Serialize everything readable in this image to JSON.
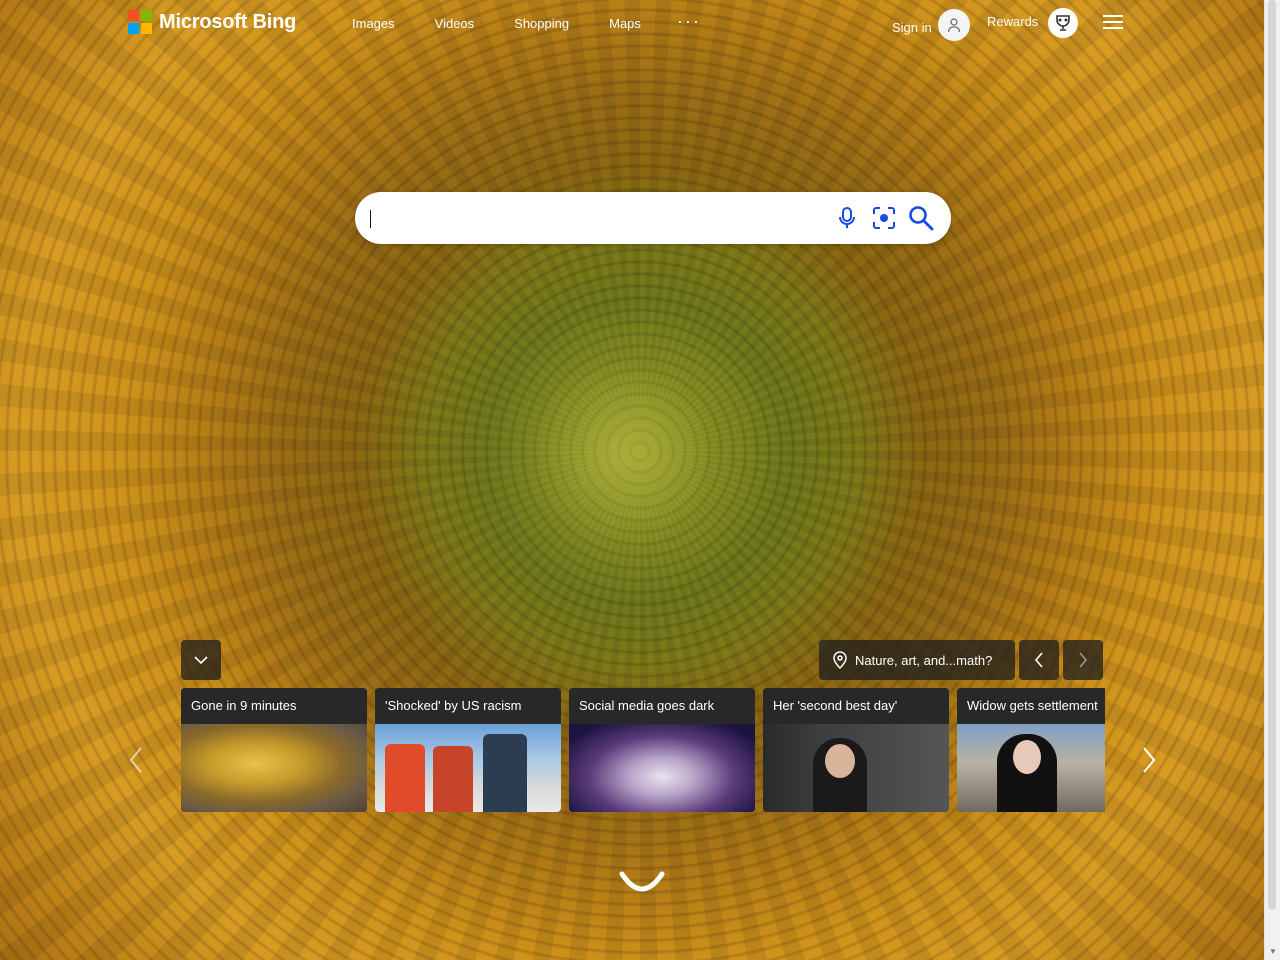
{
  "brand": {
    "name": "Microsoft Bing",
    "logo_colors": [
      "#f25022",
      "#7fba00",
      "#00a4ef",
      "#ffb900"
    ]
  },
  "nav": {
    "items": [
      "Images",
      "Videos",
      "Shopping",
      "Maps"
    ],
    "more": "···"
  },
  "account": {
    "signin_label": "Sign in",
    "rewards_label": "Rewards"
  },
  "search": {
    "value": "",
    "placeholder": ""
  },
  "hero": {
    "location_label": "Nature, art, and...math?"
  },
  "news": [
    {
      "title": "Gone in 9 minutes"
    },
    {
      "title": "'Shocked' by US racism"
    },
    {
      "title": "Social media goes dark"
    },
    {
      "title": "Her 'second best day'"
    },
    {
      "title": "Widow gets settlement"
    }
  ],
  "colors": {
    "accent": "#ffffff",
    "search_icon": "#174ae4",
    "dark_overlay": "#1e1e1e"
  }
}
